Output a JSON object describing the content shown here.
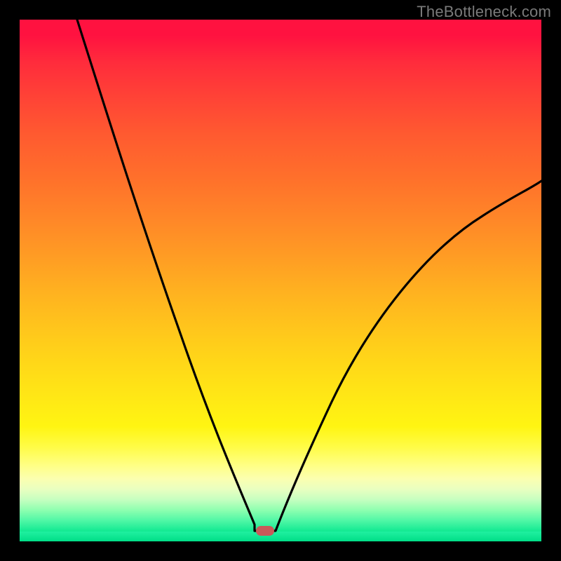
{
  "watermark": "TheBottleneck.com",
  "colors": {
    "background": "#000000",
    "curve": "#000000",
    "marker": "#c95a5a"
  },
  "chart_data": {
    "type": "line",
    "title": "",
    "xlabel": "",
    "ylabel": "",
    "xlim": [
      0,
      100
    ],
    "ylim": [
      0,
      100
    ],
    "grid": false,
    "legend": false,
    "series": [
      {
        "name": "left-curve",
        "x": [
          11,
          14,
          18,
          22,
          26,
          30,
          34,
          38,
          40,
          42,
          43.5,
          45
        ],
        "y": [
          100,
          90,
          78,
          66,
          55,
          44,
          33,
          22,
          16,
          10,
          5,
          2
        ]
      },
      {
        "name": "flat-segment",
        "x": [
          45,
          49
        ],
        "y": [
          2,
          2
        ]
      },
      {
        "name": "right-curve",
        "x": [
          49,
          52,
          56,
          60,
          65,
          70,
          76,
          82,
          88,
          94,
          100
        ],
        "y": [
          2,
          9,
          18,
          26,
          35,
          42,
          49,
          55,
          60,
          64,
          67
        ]
      }
    ],
    "marker": {
      "x": 47,
      "y": 2
    },
    "gradient_stops": [
      {
        "pos": 0,
        "color": "#ff1240"
      },
      {
        "pos": 50,
        "color": "#ffb120"
      },
      {
        "pos": 80,
        "color": "#fffc48"
      },
      {
        "pos": 100,
        "color": "#00e088"
      }
    ]
  }
}
